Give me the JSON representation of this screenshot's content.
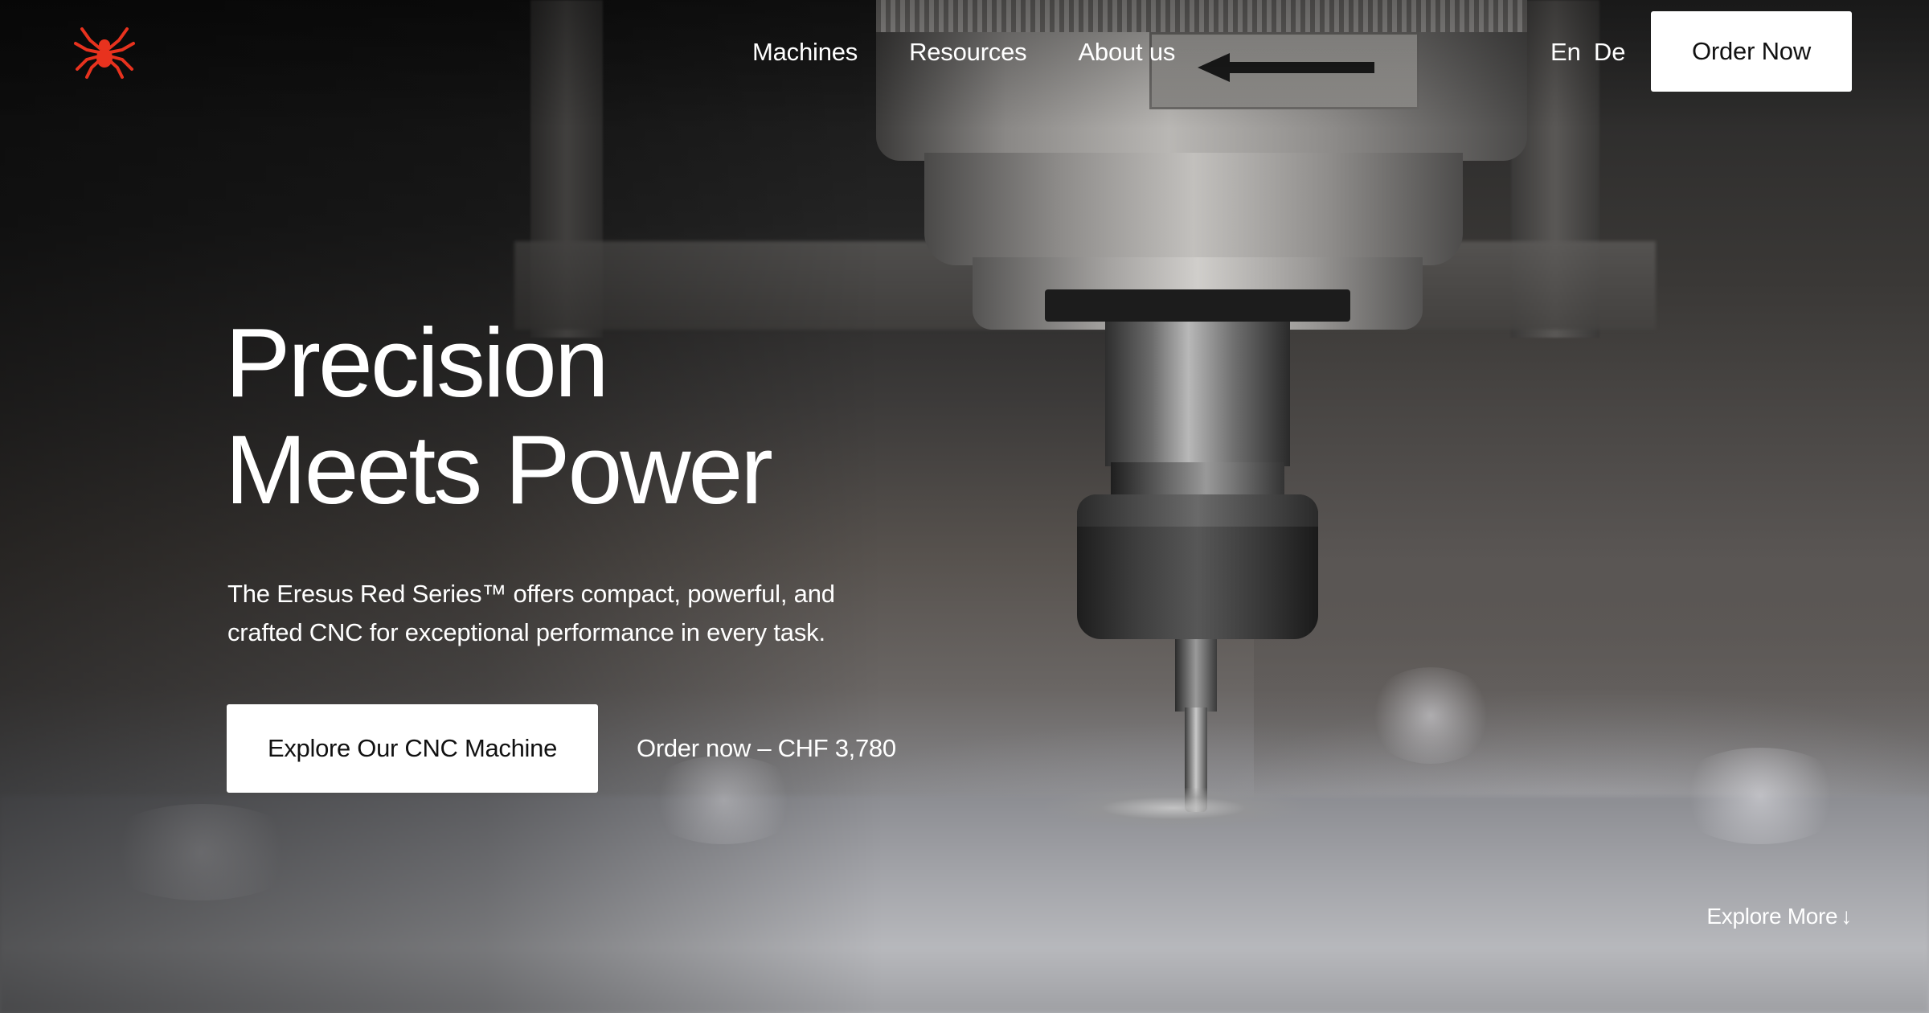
{
  "brand": {
    "logo_icon": "spider-icon",
    "accent_color": "#e8321e"
  },
  "nav": {
    "items": [
      {
        "label": "Machines"
      },
      {
        "label": "Resources"
      },
      {
        "label": "About us"
      }
    ]
  },
  "language": {
    "options": [
      "En",
      "De"
    ]
  },
  "header": {
    "order_button_label": "Order Now"
  },
  "hero": {
    "title_line_1": "Precision",
    "title_line_2": "Meets Power",
    "subtitle_line_1": "The Eresus Red Series™ offers compact, powerful, and",
    "subtitle_line_2": "crafted CNC for exceptional performance in every task.",
    "primary_cta_label": "Explore Our CNC Machine",
    "secondary_cta_label": "Order now – CHF 3,780"
  },
  "footer_hint": {
    "label": "Explore More",
    "icon": "arrow-down-icon",
    "arrow_glyph": "↓"
  }
}
